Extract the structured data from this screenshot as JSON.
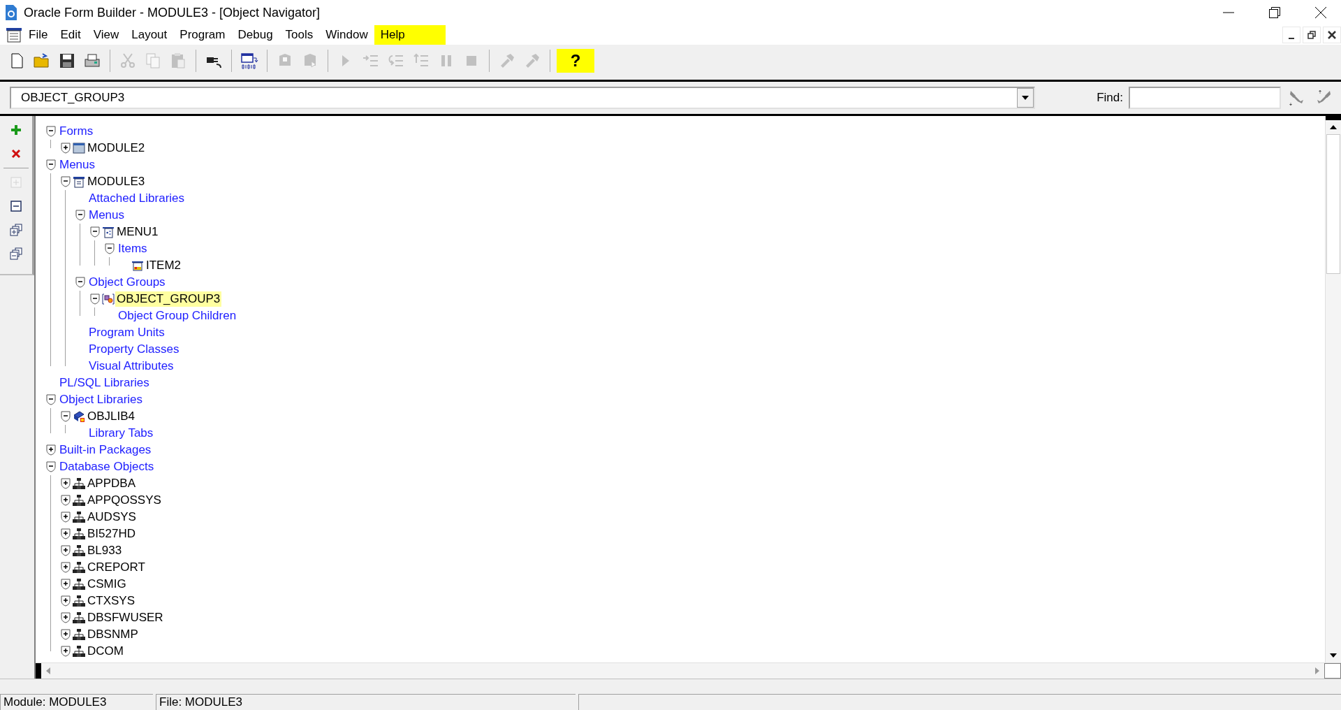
{
  "window": {
    "title": "Oracle Form Builder - MODULE3 - [Object Navigator]"
  },
  "menu": [
    {
      "label": "File",
      "highlighted": false
    },
    {
      "label": "Edit",
      "highlighted": false
    },
    {
      "label": "View",
      "highlighted": false
    },
    {
      "label": "Layout",
      "highlighted": false
    },
    {
      "label": "Program",
      "highlighted": false
    },
    {
      "label": "Debug",
      "highlighted": false
    },
    {
      "label": "Tools",
      "highlighted": false
    },
    {
      "label": "Window",
      "highlighted": false
    },
    {
      "label": "Help",
      "highlighted": true
    }
  ],
  "toolbar": [
    {
      "kind": "new",
      "disabled": false
    },
    {
      "kind": "open",
      "disabled": false
    },
    {
      "kind": "save",
      "disabled": false
    },
    {
      "kind": "print",
      "disabled": false
    },
    {
      "kind": "separator"
    },
    {
      "kind": "cut",
      "disabled": true
    },
    {
      "kind": "copy",
      "disabled": true
    },
    {
      "kind": "paste",
      "disabled": true
    },
    {
      "kind": "separator"
    },
    {
      "kind": "connect",
      "disabled": false
    },
    {
      "kind": "separator"
    },
    {
      "kind": "compile",
      "disabled": false
    },
    {
      "kind": "separator"
    },
    {
      "kind": "module",
      "disabled": true
    },
    {
      "kind": "module-run",
      "disabled": true
    },
    {
      "kind": "separator"
    },
    {
      "kind": "run",
      "disabled": true
    },
    {
      "kind": "step-into",
      "disabled": true
    },
    {
      "kind": "step-over",
      "disabled": true
    },
    {
      "kind": "step-out",
      "disabled": true
    },
    {
      "kind": "pause",
      "disabled": true
    },
    {
      "kind": "stop",
      "disabled": true
    },
    {
      "kind": "separator"
    },
    {
      "kind": "tool",
      "disabled": true
    },
    {
      "kind": "tool",
      "disabled": true
    },
    {
      "kind": "separator"
    },
    {
      "kind": "help",
      "label": "?",
      "highlighted": true
    }
  ],
  "navigator": {
    "current": "OBJECT_GROUP3",
    "find_label": "Find:"
  },
  "side_tools": [
    {
      "kind": "create",
      "disabled": false
    },
    {
      "kind": "delete",
      "disabled": false
    },
    {
      "kind": "separator"
    },
    {
      "kind": "expand",
      "disabled": true
    },
    {
      "kind": "collapse",
      "disabled": false
    },
    {
      "kind": "expand-all",
      "disabled": false
    },
    {
      "kind": "collapse-all",
      "disabled": false
    }
  ],
  "tree": [
    {
      "label": "Forms",
      "kind": "category",
      "expanded": true,
      "selected": false,
      "children": [
        {
          "label": "MODULE2",
          "kind": "form",
          "expanded": false,
          "selected": false
        }
      ]
    },
    {
      "label": "Menus",
      "kind": "category",
      "expanded": true,
      "selected": false,
      "children": [
        {
          "label": "MODULE3",
          "kind": "menu-module",
          "expanded": true,
          "selected": false,
          "children": [
            {
              "label": "Attached Libraries",
              "kind": "category",
              "selected": false
            },
            {
              "label": "Menus",
              "kind": "category",
              "expanded": true,
              "selected": false,
              "children": [
                {
                  "label": "MENU1",
                  "kind": "menu",
                  "expanded": true,
                  "selected": false,
                  "children": [
                    {
                      "label": "Items",
                      "kind": "category",
                      "expanded": true,
                      "selected": false,
                      "children": [
                        {
                          "label": "ITEM2",
                          "kind": "menu-item",
                          "selected": false
                        }
                      ]
                    }
                  ]
                }
              ]
            },
            {
              "label": "Object Groups",
              "kind": "category",
              "expanded": true,
              "selected": false,
              "children": [
                {
                  "label": "OBJECT_GROUP3",
                  "kind": "object-group",
                  "expanded": true,
                  "selected": true,
                  "children": [
                    {
                      "label": "Object Group Children",
                      "kind": "category",
                      "selected": false
                    }
                  ]
                }
              ]
            },
            {
              "label": "Program Units",
              "kind": "category",
              "selected": false
            },
            {
              "label": "Property Classes",
              "kind": "category",
              "selected": false
            },
            {
              "label": "Visual Attributes",
              "kind": "category",
              "selected": false
            }
          ]
        }
      ]
    },
    {
      "label": "PL/SQL Libraries",
      "kind": "category",
      "selected": false
    },
    {
      "label": "Object Libraries",
      "kind": "category",
      "expanded": true,
      "selected": false,
      "children": [
        {
          "label": "OBJLIB4",
          "kind": "library",
          "expanded": true,
          "selected": false,
          "children": [
            {
              "label": "Library Tabs",
              "kind": "category",
              "selected": false
            }
          ]
        }
      ]
    },
    {
      "label": "Built-in Packages",
      "kind": "category",
      "expanded": false,
      "selected": false
    },
    {
      "label": "Database Objects",
      "kind": "category",
      "expanded": true,
      "selected": false,
      "children": [
        {
          "label": "APPDBA",
          "kind": "schema",
          "expanded": false,
          "selected": false
        },
        {
          "label": "APPQOSSYS",
          "kind": "schema",
          "expanded": false,
          "selected": false
        },
        {
          "label": "AUDSYS",
          "kind": "schema",
          "expanded": false,
          "selected": false
        },
        {
          "label": "BI527HD",
          "kind": "schema",
          "expanded": false,
          "selected": false
        },
        {
          "label": "BL933",
          "kind": "schema",
          "expanded": false,
          "selected": false
        },
        {
          "label": "CREPORT",
          "kind": "schema",
          "expanded": false,
          "selected": false
        },
        {
          "label": "CSMIG",
          "kind": "schema",
          "expanded": false,
          "selected": false
        },
        {
          "label": "CTXSYS",
          "kind": "schema",
          "expanded": false,
          "selected": false
        },
        {
          "label": "DBSFWUSER",
          "kind": "schema",
          "expanded": false,
          "selected": false
        },
        {
          "label": "DBSNMP",
          "kind": "schema",
          "expanded": false,
          "selected": false
        },
        {
          "label": "DCOM",
          "kind": "schema",
          "expanded": false,
          "selected": false
        }
      ]
    }
  ],
  "status_bar": [
    {
      "text": "Module: MODULE3"
    },
    {
      "text": "File: MODULE3"
    }
  ]
}
